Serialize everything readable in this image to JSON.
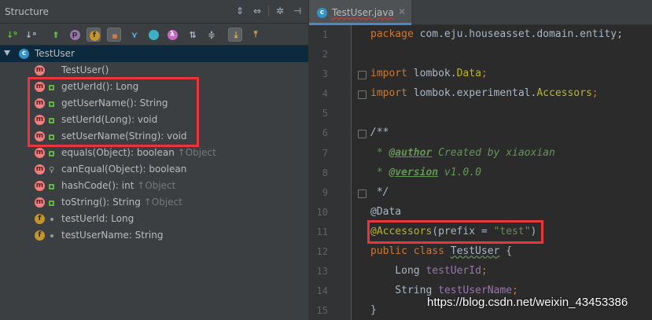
{
  "structure": {
    "title": "Structure",
    "tree": [
      {
        "label": "TestUser",
        "badge": "c"
      },
      {
        "label": "TestUser()",
        "badge": "m"
      },
      {
        "label": "getUerId(): Long",
        "badge": "m"
      },
      {
        "label": "getUserName(): String",
        "badge": "m"
      },
      {
        "label": "setUerId(Long): void",
        "badge": "m"
      },
      {
        "label": "setUserName(String): void",
        "badge": "m"
      },
      {
        "label": "equals(Object): boolean",
        "inherited": "↑Object",
        "badge": "m"
      },
      {
        "label": "canEqual(Object): boolean",
        "badge": "m"
      },
      {
        "label": "hashCode(): int",
        "inherited": "↑Object",
        "badge": "m"
      },
      {
        "label": "toString(): String",
        "inherited": "↑Object",
        "badge": "m"
      },
      {
        "label": "testUerId: Long",
        "badge": "f"
      },
      {
        "label": "testUserName: String",
        "badge": "f"
      }
    ]
  },
  "editor": {
    "tab_title": "TestUser.java",
    "line_numbers": [
      "1",
      "2",
      "3",
      "4",
      "5",
      "6",
      "7",
      "8",
      "9",
      "10",
      "11",
      "12",
      "13",
      "14",
      "15"
    ],
    "code": {
      "l1_kw": "package",
      "l1_rest": " com.eju.houseasset.domain.entity;",
      "l3_kw": "import",
      "l3_pkg": " lombok.",
      "l3_cls": "Data",
      "l3_end": ";",
      "l4_kw": "import",
      "l4_pkg": " lombok.experimental.",
      "l4_cls": "Accessors",
      "l4_end": ";",
      "l6": "/**",
      "l7_star": " * ",
      "l7_tag": "@author",
      "l7_rest": " Created by xiaoxian",
      "l8_star": " * ",
      "l8_tag": "@version",
      "l8_rest": " v1.0.0",
      "l9": " */",
      "l10": "@Data",
      "l11_ann": "@Accessors",
      "l11_open": "(prefix = ",
      "l11_str": "\"test\"",
      "l11_close": ")",
      "l12_kw": "public class",
      "l12_sp": " ",
      "l12_name": "TestUser",
      "l12_rest": " {",
      "l13_type": "    Long ",
      "l13_field": "testUerId",
      "l13_end": ";",
      "l14_type": "    String ",
      "l14_field": "testUserName",
      "l14_end": ";",
      "l15": "}"
    }
  },
  "watermark": "https://blog.csdn.net/weixin_43453386",
  "colors": {
    "highlight_box": "#e8363c",
    "selection": "#0d293e"
  }
}
